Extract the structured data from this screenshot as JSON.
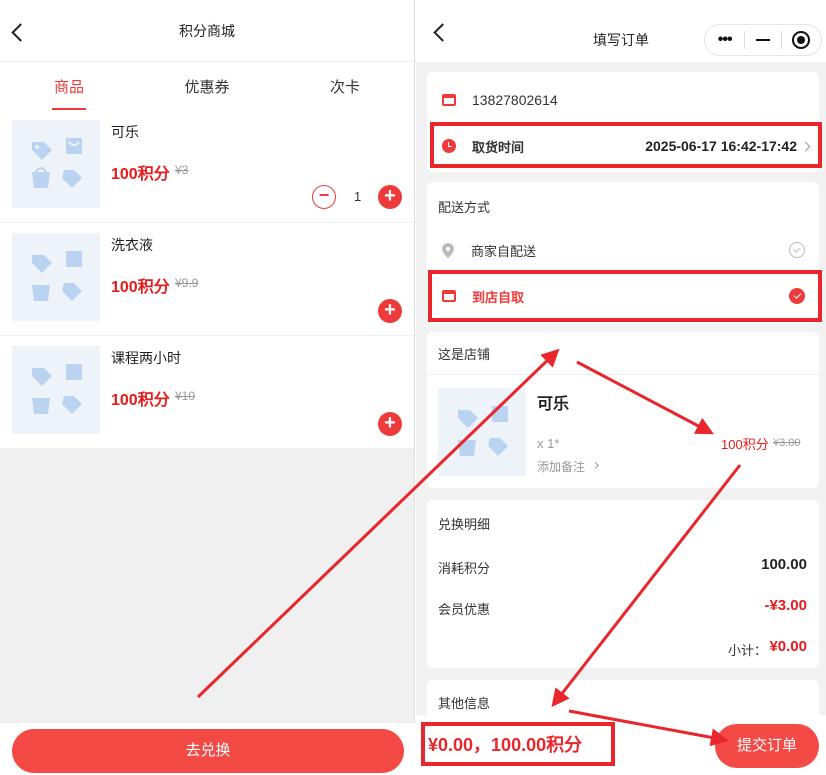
{
  "left": {
    "title": "积分商城",
    "tabs": [
      {
        "label": "商品",
        "active": true
      },
      {
        "label": "优惠券",
        "active": false
      },
      {
        "label": "次卡",
        "active": false
      }
    ],
    "items": [
      {
        "name": "可乐",
        "price": "100积分",
        "original": "¥3",
        "quantity": "1"
      },
      {
        "name": "洗衣液",
        "price": "100积分",
        "original": "¥9.9"
      },
      {
        "name": "课程两小时",
        "price": "100积分",
        "original": "¥10"
      }
    ],
    "redeem_button": "去兑换"
  },
  "right": {
    "title": "填写订单",
    "capsule": {
      "more": "•••"
    },
    "contact": {
      "phone": "13827802614",
      "pickup_label": "取货时间",
      "pickup_time": "2025-06-17 16:42-17:42"
    },
    "delivery": {
      "title": "配送方式",
      "options": [
        {
          "label": "商家自配送",
          "selected": false
        },
        {
          "label": "到店自取",
          "selected": true
        }
      ]
    },
    "store": {
      "name": "这是店铺",
      "item_name": "可乐",
      "quantity": "x 1*",
      "remark": "添加备注",
      "price": "100积分",
      "original": "¥3.00"
    },
    "detail": {
      "title": "兑换明细",
      "points_label": "消耗积分",
      "points_value": "100.00",
      "member_label": "会员优惠",
      "member_value": "-¥3.00",
      "subtotal_label": "小计：",
      "subtotal_value": "¥0.00"
    },
    "other": {
      "title": "其他信息"
    },
    "footer": {
      "total": "¥0.00，100.00积分",
      "submit": "提交订单"
    }
  },
  "colors": {
    "accent": "#ee3a3a",
    "highlight": "#e8262b",
    "button": "#f34a45"
  }
}
